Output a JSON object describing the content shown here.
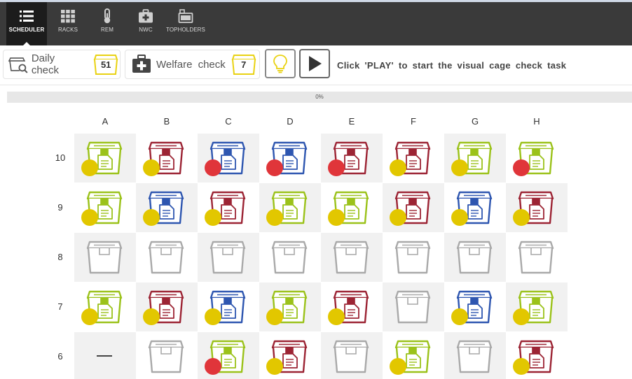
{
  "nav": {
    "items": [
      {
        "label": "SCHEDULER",
        "icon": "list-icon",
        "active": true
      },
      {
        "label": "RACKS",
        "icon": "grid-icon",
        "active": false
      },
      {
        "label": "REM",
        "icon": "thermometer-icon",
        "active": false
      },
      {
        "label": "NWC",
        "icon": "medical-kit-icon",
        "active": false
      },
      {
        "label": "TOPHOLDERS",
        "icon": "topholder-icon",
        "active": false
      }
    ]
  },
  "toolbar": {
    "daily_check": {
      "label": "Daily check",
      "count": "51"
    },
    "welfare_check": {
      "label": "Welfare check",
      "count": "7"
    },
    "task_hint": "Click 'PLAY' to start the visual cage check task"
  },
  "progress": {
    "text": "0%",
    "value": 0
  },
  "colors": {
    "green": "#9bc21a",
    "red": "#9c2434",
    "blue": "#2e56b0",
    "empty": "#a9a9a9",
    "dot_yellow": "#e2c700",
    "dot_red": "#e0353a",
    "badge_yellow": "#e9d212"
  },
  "rack": {
    "columns": [
      "A",
      "B",
      "C",
      "D",
      "E",
      "F",
      "G",
      "H"
    ],
    "rows": [
      {
        "label": "10",
        "cells": [
          {
            "cage": "green",
            "dot": "yellow"
          },
          {
            "cage": "red",
            "dot": "yellow"
          },
          {
            "cage": "blue",
            "dot": "red"
          },
          {
            "cage": "blue",
            "dot": "red"
          },
          {
            "cage": "red",
            "dot": "red"
          },
          {
            "cage": "red",
            "dot": "yellow"
          },
          {
            "cage": "green",
            "dot": "yellow"
          },
          {
            "cage": "green",
            "dot": "red"
          }
        ]
      },
      {
        "label": "9",
        "cells": [
          {
            "cage": "green",
            "dot": "yellow"
          },
          {
            "cage": "blue",
            "dot": "yellow"
          },
          {
            "cage": "red",
            "dot": "yellow"
          },
          {
            "cage": "green",
            "dot": "yellow"
          },
          {
            "cage": "green",
            "dot": "yellow"
          },
          {
            "cage": "red",
            "dot": "yellow"
          },
          {
            "cage": "blue",
            "dot": "yellow"
          },
          {
            "cage": "red",
            "dot": "yellow"
          }
        ]
      },
      {
        "label": "8",
        "cells": [
          {
            "cage": "empty",
            "dot": null
          },
          {
            "cage": "empty",
            "dot": null
          },
          {
            "cage": "empty",
            "dot": null
          },
          {
            "cage": "empty",
            "dot": null
          },
          {
            "cage": "empty",
            "dot": null
          },
          {
            "cage": "empty",
            "dot": null
          },
          {
            "cage": "empty",
            "dot": null
          },
          {
            "cage": "empty",
            "dot": null
          }
        ]
      },
      {
        "label": "7",
        "cells": [
          {
            "cage": "green",
            "dot": "yellow"
          },
          {
            "cage": "red",
            "dot": "yellow"
          },
          {
            "cage": "blue",
            "dot": "yellow"
          },
          {
            "cage": "green",
            "dot": "yellow"
          },
          {
            "cage": "red",
            "dot": "yellow"
          },
          {
            "cage": "empty",
            "dot": null
          },
          {
            "cage": "blue",
            "dot": "yellow"
          },
          {
            "cage": "green",
            "dot": "yellow"
          }
        ]
      },
      {
        "label": "6",
        "cells": [
          {
            "cage": "none",
            "dot": null
          },
          {
            "cage": "empty",
            "dot": null
          },
          {
            "cage": "green",
            "dot": "red"
          },
          {
            "cage": "red",
            "dot": "yellow"
          },
          {
            "cage": "empty",
            "dot": null
          },
          {
            "cage": "green",
            "dot": "yellow"
          },
          {
            "cage": "empty",
            "dot": null
          },
          {
            "cage": "red",
            "dot": "yellow"
          }
        ]
      }
    ]
  }
}
